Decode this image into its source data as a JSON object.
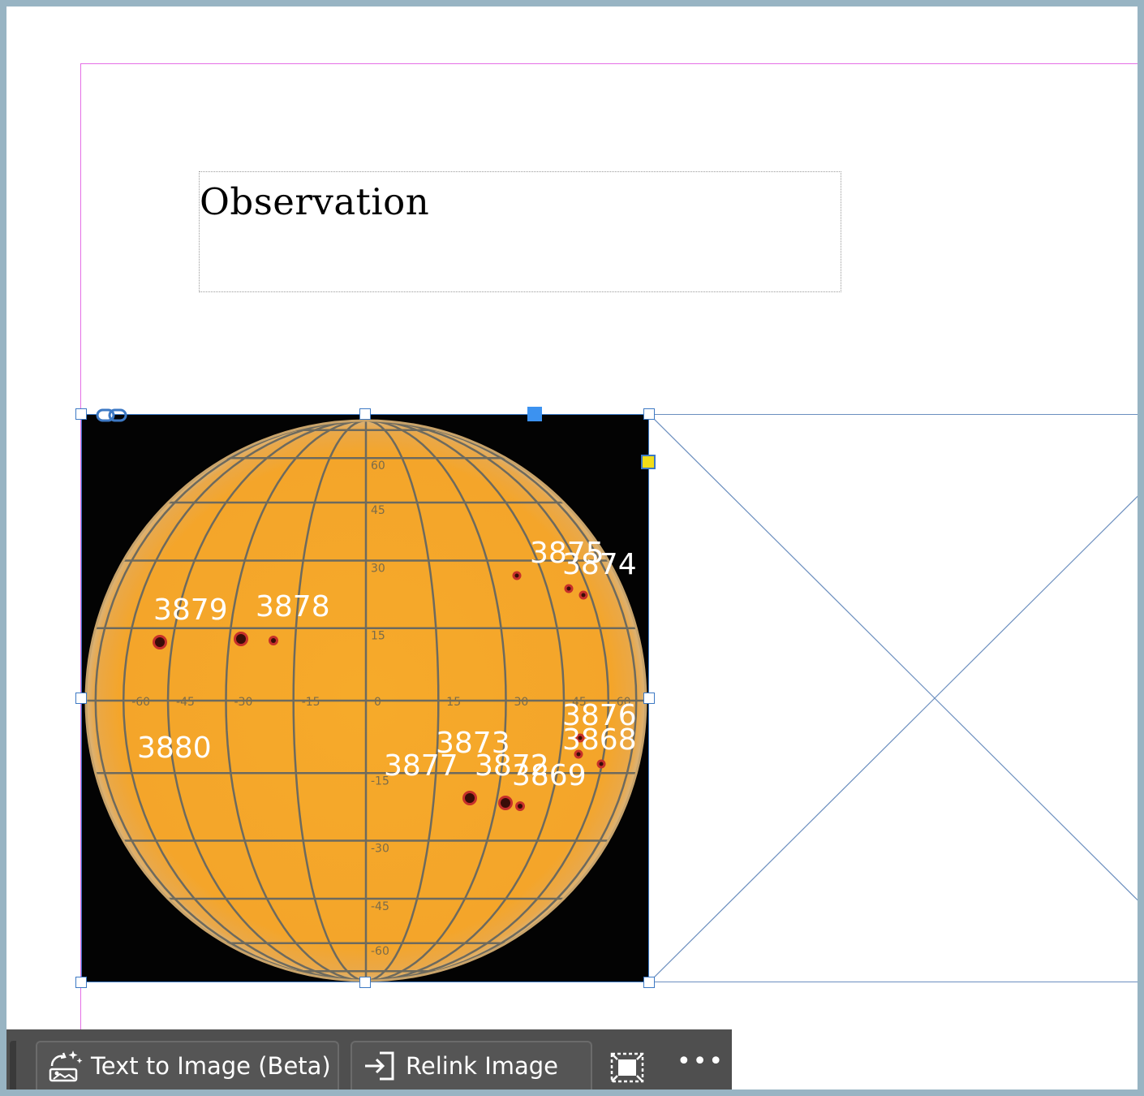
{
  "document": {
    "text_frame": {
      "content": "Observation"
    },
    "image": {
      "latitude_labels": [
        "60",
        "45",
        "30",
        "15",
        "0",
        "-15",
        "-30",
        "-45",
        "-60"
      ],
      "longitude_labels": [
        "-60",
        "-45",
        "-30",
        "-15",
        "0",
        "15",
        "30",
        "45",
        "60"
      ],
      "region_labels": [
        "3875",
        "3874",
        "3879",
        "3878",
        "3876",
        "3880",
        "3873",
        "3868",
        "3877",
        "3872",
        "3869"
      ]
    }
  },
  "taskbar": {
    "text_to_image_label": "Text to Image (Beta)",
    "relink_label": "Relink Image",
    "more_label": "•••"
  },
  "colors": {
    "margin_guide": "#e46fe6",
    "frame_selection": "#3d79c4",
    "sun_surface": "#f5a623",
    "grid_lines": "#6d6a5e",
    "taskbar_bg": "#4f4f4f"
  }
}
